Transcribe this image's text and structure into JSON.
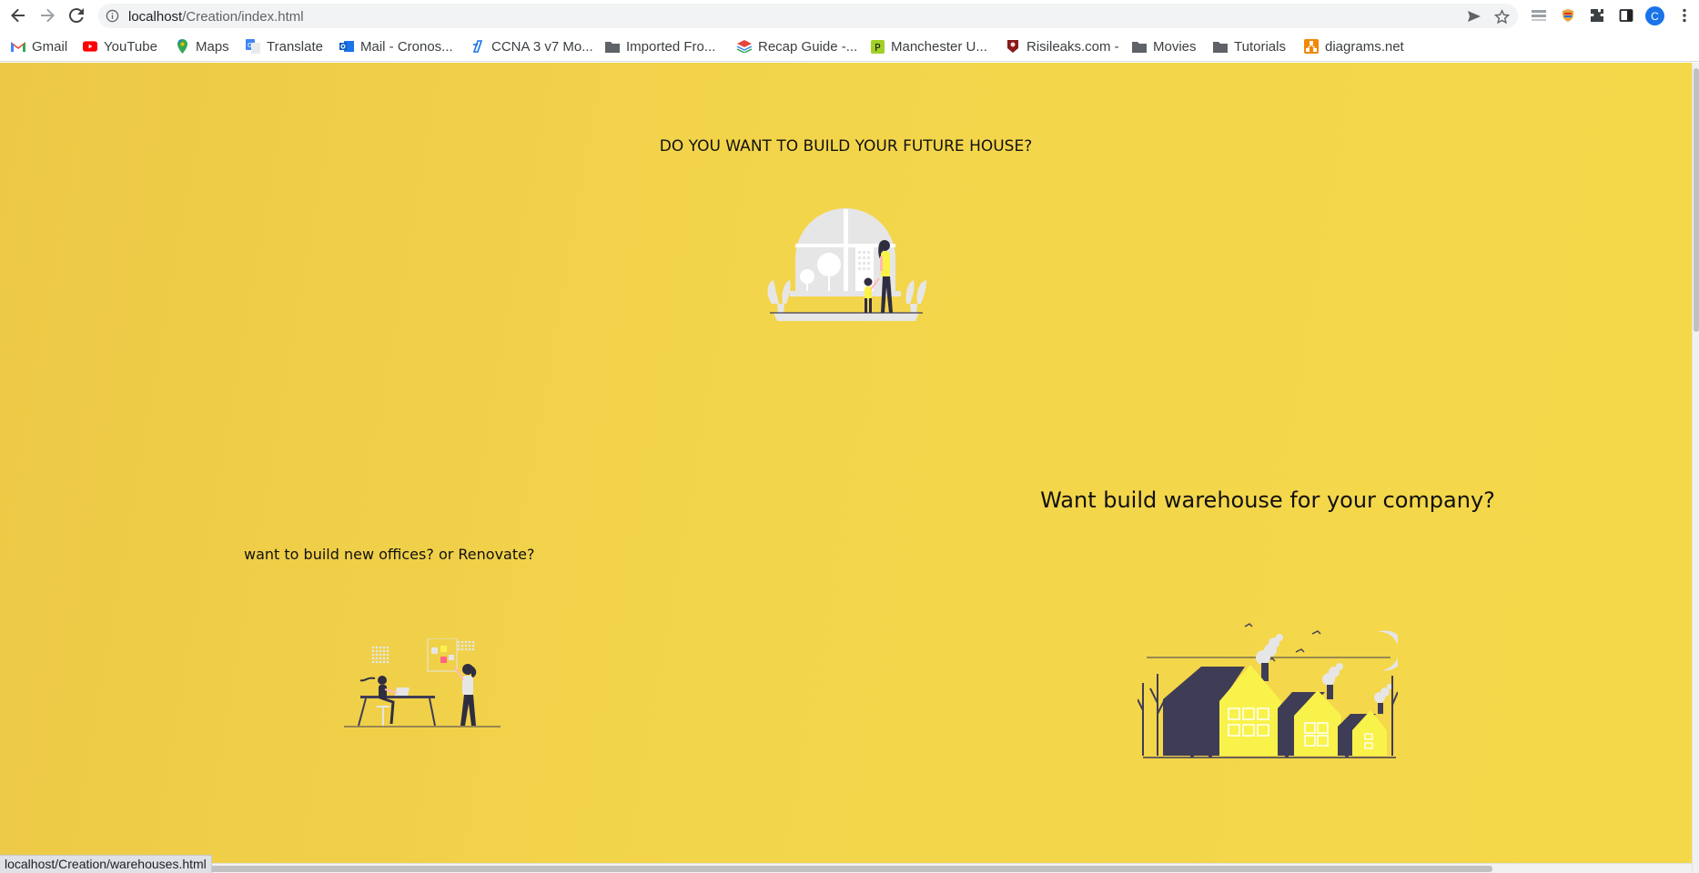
{
  "browser": {
    "url_host": "localhost",
    "url_path": "/Creation/index.html",
    "avatar_letter": "C",
    "bookmarks": [
      {
        "label": "Gmail",
        "icon": "gmail-icon"
      },
      {
        "label": "YouTube",
        "icon": "youtube-icon"
      },
      {
        "label": "Maps",
        "icon": "maps-icon"
      },
      {
        "label": "Translate",
        "icon": "translate-icon"
      },
      {
        "label": "Mail - Cronos...",
        "icon": "outlook-icon"
      },
      {
        "label": "CCNA 3 v7 Mo...",
        "icon": "ccna-icon"
      },
      {
        "label": "Imported Fro...",
        "icon": "folder-icon"
      },
      {
        "label": "Recap Guide -...",
        "icon": "recap-icon"
      },
      {
        "label": "Manchester U...",
        "icon": "manchester-icon"
      },
      {
        "label": "Risileaks.com -",
        "icon": "risileaks-icon"
      },
      {
        "label": "Movies",
        "icon": "folder-icon"
      },
      {
        "label": "Tutorials",
        "icon": "folder-icon"
      },
      {
        "label": "diagrams.net",
        "icon": "diagrams-icon"
      }
    ],
    "status_url": "localhost/Creation/warehouses.html"
  },
  "page": {
    "house_question": "DO YOU WANT TO BUILD YOUR FUTURE HOUSE?",
    "warehouse_question": "Want build warehouse for your company?",
    "office_question": "want to build new offices? or Renovate?"
  },
  "colors": {
    "background": "#f3d54b",
    "illustration_dark": "#3f3d56",
    "illustration_yellow": "#f9f24b",
    "illustration_gray": "#e6e6e6",
    "accent_pink": "#ff6584"
  }
}
